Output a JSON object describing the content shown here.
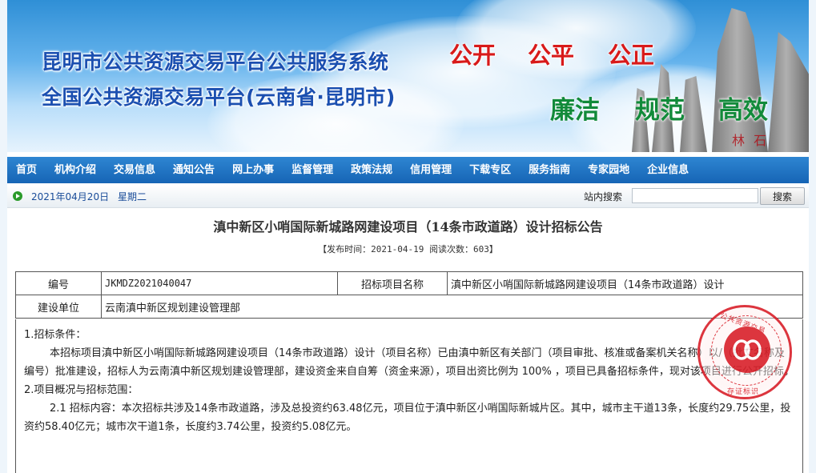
{
  "banner": {
    "title_line1": "昆明市公共资源交易平台公共服务系统",
    "title_line2": "全国公共资源交易平台(云南省·昆明市)",
    "slogans_red": [
      "公开",
      "公平",
      "公正"
    ],
    "slogans_green": [
      "廉洁",
      "规范",
      "高效"
    ],
    "carving": "林 石"
  },
  "nav": {
    "items": [
      "首页",
      "机构介绍",
      "交易信息",
      "通知公告",
      "网上办事",
      "监督管理",
      "政策法规",
      "信用管理",
      "下载专区",
      "服务指南",
      "专家园地",
      "企业信息"
    ]
  },
  "datebar": {
    "date": "2021年04月20日",
    "weekday": "星期二",
    "search_label": "站内搜索",
    "search_value": "",
    "search_button": "搜索"
  },
  "article": {
    "title": "滇中新区小哨国际新城路网建设项目（14条市政道路）设计招标公告",
    "meta": "【发布时间：2021-04-19  阅读次数：603】",
    "table": {
      "row1": {
        "label_id": "编号",
        "value_id": "JKMDZ2021040047",
        "label_project": "招标项目名称",
        "value_project": "滇中新区小哨国际新城路网建设项目（14条市政道路）设计"
      },
      "row2": {
        "label_unit": "建设单位",
        "value_unit": "云南滇中新区规划建设管理部"
      }
    },
    "content": {
      "h1": "1.招标条件：",
      "p1": "本招标项目滇中新区小哨国际新城路网建设项目（14条市政道路）设计（项目名称）已由滇中新区有关部门（项目审批、核准或备案机关名称）以/（批文名称及编号）批准建设，招标人为云南滇中新区规划建设管理部，建设资金来自自筹（资金来源），项目出资比例为 100% ，项目已具备招标条件，现对该项目进行公开招标。",
      "h2": "2.项目概况与招标范围：",
      "p2": "2.1 招标内容：本次招标共涉及14条市政道路，涉及总投资约63.48亿元，项目位于滇中新区小哨国际新城片区。其中，城市主干道13条，长度约29.75公里，投资约58.40亿元；城市次干道1条，长度约3.74公里，投资约5.08亿元。"
    }
  },
  "seal": {
    "text_top": "公共资源交易",
    "text_bottom": "存证标识"
  }
}
